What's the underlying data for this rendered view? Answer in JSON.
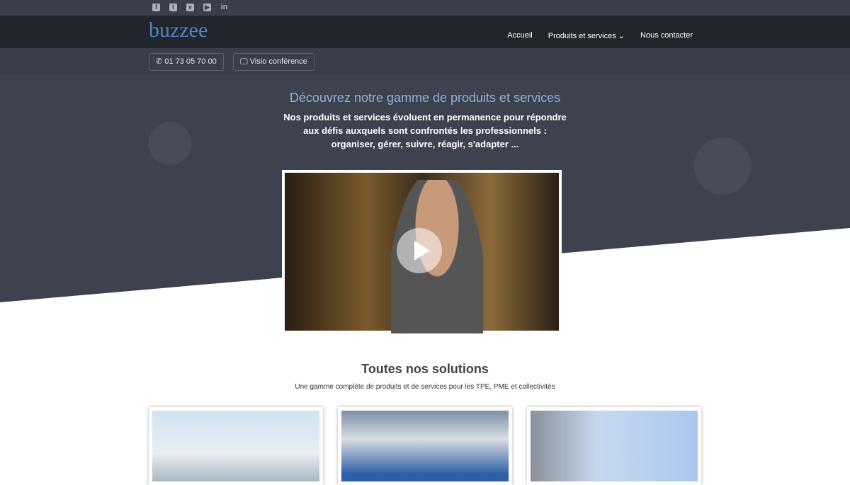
{
  "social": [
    {
      "icon": "facebook-icon",
      "g": "f"
    },
    {
      "icon": "twitter-icon",
      "g": "t"
    },
    {
      "icon": "vimeo-icon",
      "g": "v"
    },
    {
      "icon": "youtube-icon",
      "g": "▶"
    },
    {
      "icon": "linkedin-icon",
      "g": "in"
    }
  ],
  "header": {
    "logo": "buzzee",
    "nav": [
      "Accueil",
      "Produits et services ⌄",
      "Nous contacter"
    ]
  },
  "subbar": {
    "phone": "01 73 05 70 00",
    "visio": "Visio conférence"
  },
  "hero": {
    "title": "Découvrez notre gamme de produits et services",
    "text": [
      "Nos produits et services évoluent en permanence pour répondre",
      "aux défis auxquels sont confrontés les professionnels :",
      "organiser, gérer, suivre, réagir, s'adapter ..."
    ]
  },
  "solutions": {
    "title": "Toutes nos solutions",
    "subtitle": "Une gamme complète de produits et de services pour les TPE, PME et collectivités"
  }
}
